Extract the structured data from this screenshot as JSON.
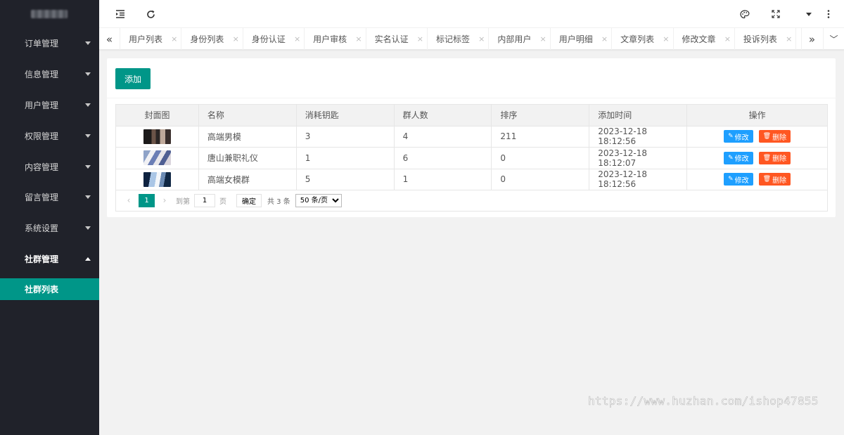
{
  "sidebar": {
    "menu": [
      {
        "label": "订单管理"
      },
      {
        "label": "信息管理"
      },
      {
        "label": "用户管理"
      },
      {
        "label": "权限管理"
      },
      {
        "label": "内容管理"
      },
      {
        "label": "留言管理"
      },
      {
        "label": "系统设置"
      },
      {
        "label": "社群管理"
      }
    ],
    "submenu": {
      "label": "社群列表"
    },
    "accent_color": "#009688",
    "background_color": "#20222a"
  },
  "header": {
    "icons": [
      "menu-fold-icon",
      "refresh-icon",
      "theme-icon",
      "fullscreen-icon",
      "dropdown-icon",
      "more-icon"
    ]
  },
  "tabs": {
    "items": [
      {
        "label": "用户列表"
      },
      {
        "label": "身份列表"
      },
      {
        "label": "身份认证"
      },
      {
        "label": "用户审核"
      },
      {
        "label": "实名认证"
      },
      {
        "label": "标记标签"
      },
      {
        "label": "内部用户"
      },
      {
        "label": "用户明细"
      },
      {
        "label": "文章列表"
      },
      {
        "label": "修改文章"
      },
      {
        "label": "投诉列表"
      }
    ],
    "close_glyph": "×",
    "prev_glyph": "«",
    "next_glyph": "»",
    "expand_glyph": "﹀"
  },
  "content": {
    "add_button": "添加",
    "table": {
      "columns": [
        "封面图",
        "名称",
        "消耗钥匙",
        "群人数",
        "排序",
        "添加时间",
        "操作"
      ],
      "rows": [
        {
          "name": "高端男模",
          "keys": "3",
          "members": "4",
          "sort": "211",
          "time": "2023-12-18 18:12:56"
        },
        {
          "name": "唐山兼职礼仪",
          "keys": "1",
          "members": "6",
          "sort": "0",
          "time": "2023-12-18 18:12:07"
        },
        {
          "name": "高端女模群",
          "keys": "5",
          "members": "1",
          "sort": "0",
          "time": "2023-12-18 18:12:56"
        }
      ],
      "edit_label": "修改",
      "delete_label": "删除",
      "edit_color": "#1e9fff",
      "delete_color": "#ff5722"
    },
    "pagination": {
      "current_page": "1",
      "goto_prefix": "到第",
      "goto_value": "1",
      "goto_suffix": "页",
      "confirm": "确定",
      "total": "共 3 条",
      "page_size": "50 条/页"
    }
  },
  "watermark": "https://www.huzhan.com/ishop47855"
}
